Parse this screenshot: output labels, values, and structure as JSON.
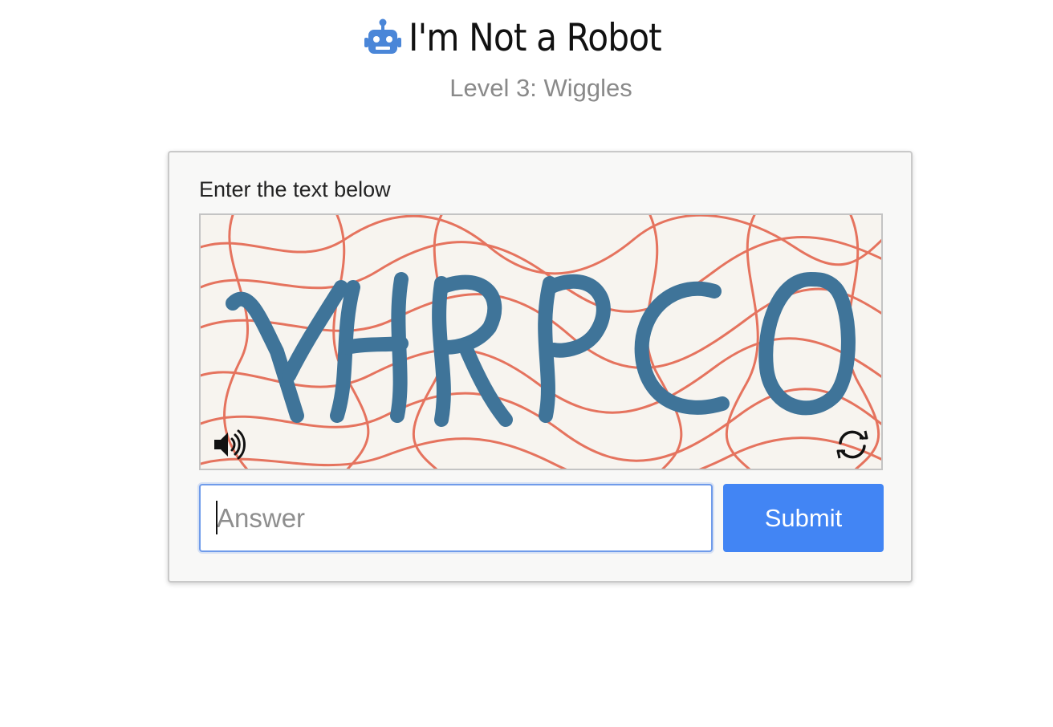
{
  "header": {
    "icon": "robot-icon",
    "title": "I'm Not a Robot",
    "subtitle": "Level 3: Wiggles"
  },
  "captcha_card": {
    "prompt": "Enter the text below",
    "captcha_text": "YHRPCO",
    "audio_icon": "speaker-icon",
    "refresh_icon": "refresh-icon",
    "answer": {
      "value": "",
      "placeholder": "Answer"
    },
    "submit_label": "Submit"
  },
  "colors": {
    "accent": "#4285f4",
    "robot_icon": "#4a86d8",
    "captcha_text": "#3f7499",
    "captcha_noise": "#e4664f",
    "subtitle": "#8a8a8a"
  }
}
